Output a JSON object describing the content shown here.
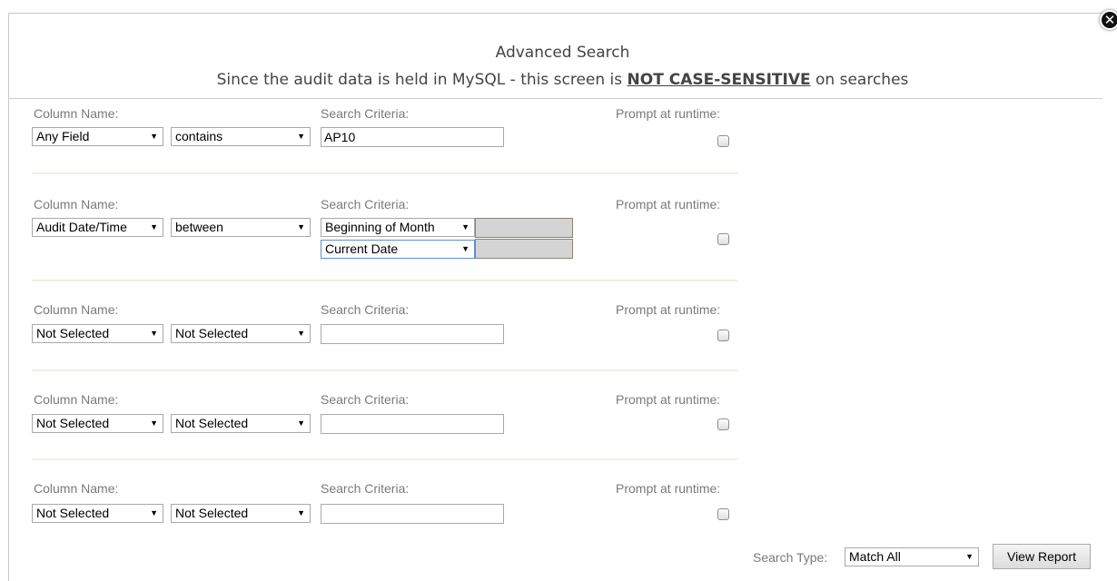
{
  "header": {
    "title": "Advanced Search",
    "subtitle_prefix": "Since the audit data is held in MySQL - this screen is ",
    "subtitle_emph": "NOT CASE-SENSITIVE",
    "subtitle_suffix": " on searches",
    "close_icon": "x-close-icon"
  },
  "labels": {
    "column_name": "Column Name:",
    "search_criteria": "Search Criteria:",
    "prompt": "Prompt at runtime:"
  },
  "rows": [
    {
      "column": "Any Field",
      "operator": "contains",
      "criteria": "AP10",
      "prompt": false
    },
    {
      "column": "Audit Date/Time",
      "operator": "between",
      "criteria_from": "Beginning of Month",
      "criteria_to": "Current Date",
      "prompt": false
    },
    {
      "column": "Not Selected",
      "operator": "Not Selected",
      "criteria": "",
      "prompt": false
    },
    {
      "column": "Not Selected",
      "operator": "Not Selected",
      "criteria": "",
      "prompt": false
    },
    {
      "column": "Not Selected",
      "operator": "Not Selected",
      "criteria": "",
      "prompt": false
    }
  ],
  "footer": {
    "search_type_label": "Search Type:",
    "search_type_value": "Match All",
    "view_report_label": "View Report"
  },
  "arrow_glyph": "▼"
}
